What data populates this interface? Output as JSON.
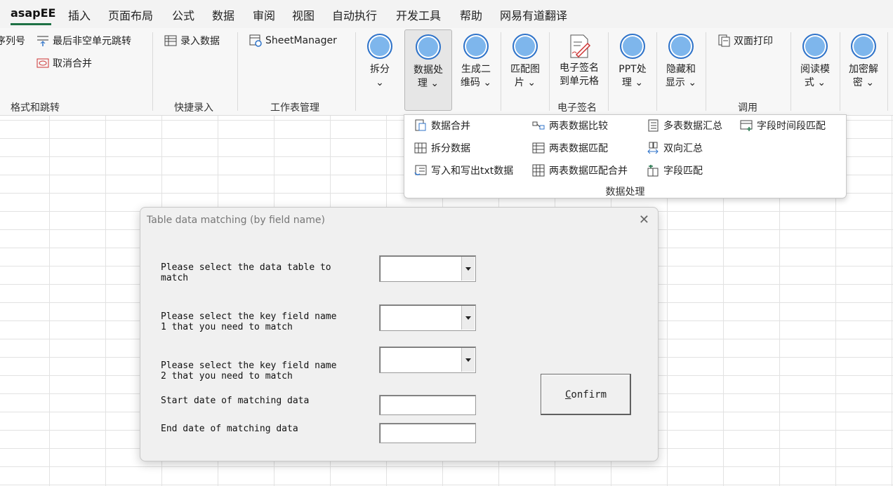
{
  "menu": {
    "tabs": [
      "asapEE",
      "插入",
      "页面布局",
      "公式",
      "数据",
      "审阅",
      "视图",
      "自动执行",
      "开发工具",
      "帮助",
      "网易有道翻译"
    ],
    "active": "asapEE"
  },
  "ribbon": {
    "group_format": {
      "truncated_item": "序列号",
      "last_nonempty": "最后非空单元跳转",
      "unmerge": "取消合并",
      "label": "格式和跳转"
    },
    "group_quick": {
      "entry": "录入数据",
      "label": "快捷录入"
    },
    "group_sheet": {
      "manager": "SheetManager",
      "label": "工作表管理"
    },
    "big_buttons": [
      {
        "label": "拆分\n⌄"
      },
      {
        "label": "数据处\n理 ⌄"
      },
      {
        "label": "生成二\n维码 ⌄"
      },
      {
        "label": "匹配图\n片 ⌄"
      }
    ],
    "signature": {
      "button": "电子签名\n到单元格",
      "label": "电子签名"
    },
    "more_buttons": [
      {
        "label": "PPT处\n理 ⌄"
      },
      {
        "label": "隐藏和\n显示 ⌄"
      }
    ],
    "call_group": {
      "duplex": "双面打印",
      "label": "调用"
    },
    "end_buttons": [
      {
        "label": "阅读模\n式 ⌄"
      },
      {
        "label": "加密解\n密 ⌄"
      }
    ]
  },
  "dropdown": {
    "items": [
      "数据合并",
      "两表数据比较",
      "多表数据汇总",
      "字段时间段匹配",
      "拆分数据",
      "两表数据匹配",
      "双向汇总",
      "写入和写出txt数据",
      "两表数据匹配合并",
      "字段匹配"
    ],
    "label": "数据处理"
  },
  "dialog": {
    "title": "Table data matching (by field name)",
    "close": "✕",
    "fields": {
      "table": "Please select the data table to\nmatch",
      "key1": "Please select the key field name\n1 that you need to match",
      "key2": "Please select the key field name\n2 that you need to match",
      "start": "Start date of matching data",
      "end": "End date of matching data"
    },
    "confirm_first": "C",
    "confirm_rest": "onfirm"
  },
  "colors": {
    "accent": "#1e7145",
    "circle_fill": "#7eb6ec",
    "circle_border": "#2f73c9"
  }
}
